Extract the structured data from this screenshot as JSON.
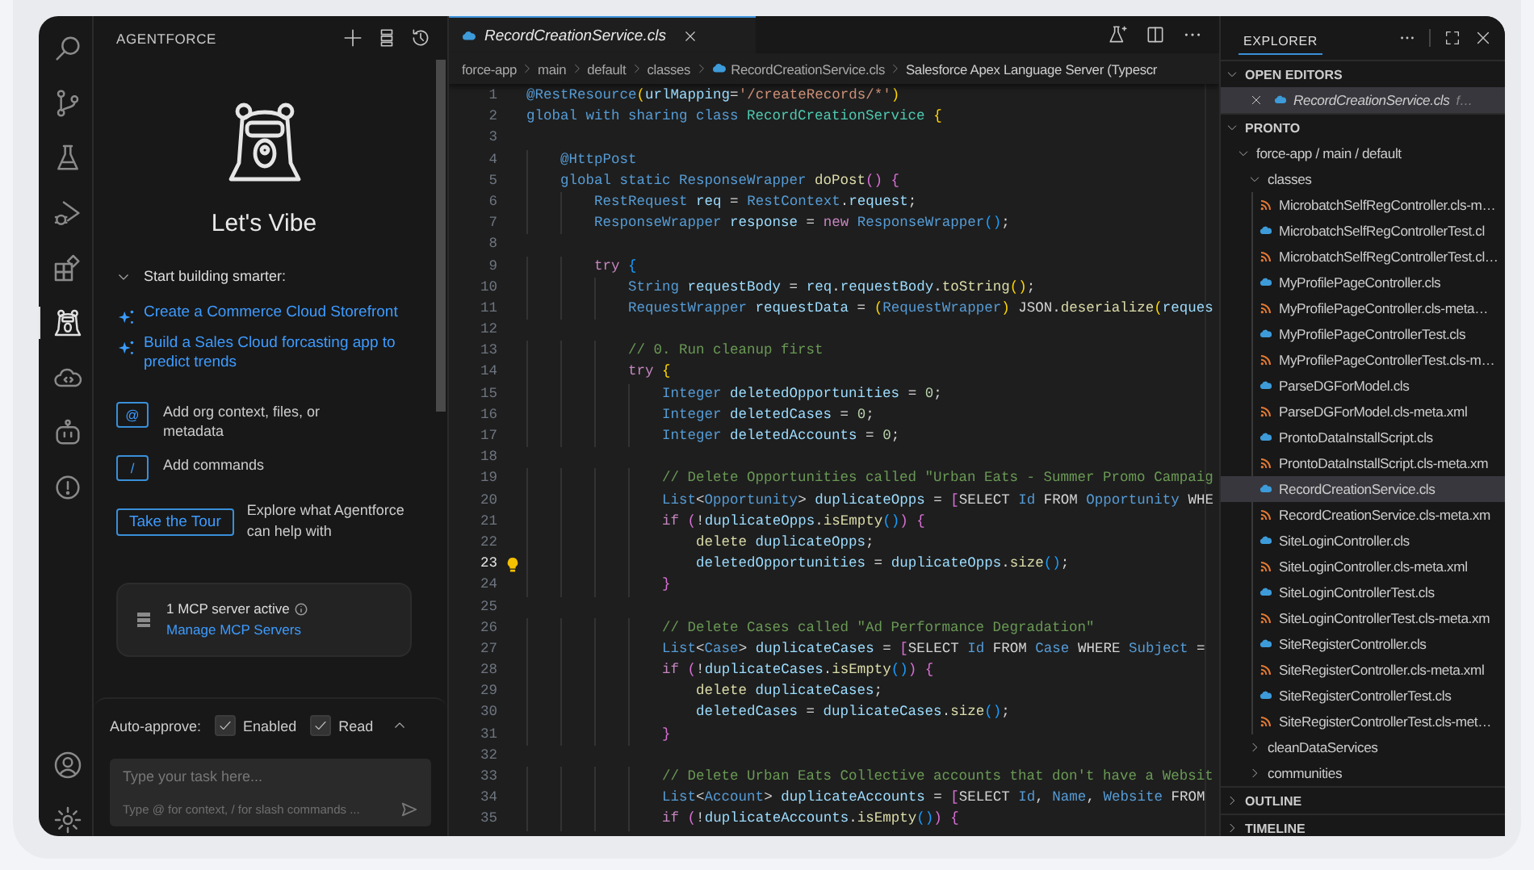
{
  "activity_bar": {
    "items": [
      {
        "kind": "search",
        "selected": false
      },
      {
        "kind": "source-control",
        "selected": false
      },
      {
        "kind": "flask",
        "selected": false
      },
      {
        "kind": "run-debug",
        "selected": false
      },
      {
        "kind": "extensions",
        "selected": false
      },
      {
        "kind": "agent",
        "selected": true
      },
      {
        "kind": "cloud",
        "selected": false
      },
      {
        "kind": "robot",
        "selected": false
      },
      {
        "kind": "alert",
        "selected": false
      }
    ],
    "bottom_items": [
      {
        "kind": "account",
        "selected": false
      },
      {
        "kind": "gear",
        "selected": false
      }
    ]
  },
  "agent_panel": {
    "title": "AGENTFORCE",
    "heading": "Let's Vibe",
    "section": {
      "label": "Start building smarter:",
      "expanded": true
    },
    "suggestions": [
      "Create a Commerce Cloud Storefront",
      "Build a Sales Cloud forcasting app to predict trends"
    ],
    "hints": [
      {
        "key": "@",
        "label": "Add org context, files, or metadata"
      },
      {
        "key": "/",
        "label": "Add commands"
      }
    ],
    "tour": {
      "button": "Take the Tour",
      "text": "Explore what Agentforce can help with"
    },
    "mcp": {
      "status": "1 MCP server active",
      "link": "Manage MCP Servers"
    },
    "auto_approve": {
      "label": "Auto-approve:",
      "expanded": false,
      "options": [
        {
          "label": "Enabled",
          "checked": true
        },
        {
          "label": "Read",
          "checked": true
        }
      ]
    },
    "input": {
      "placeholder": "Type your task here...",
      "hint": "Type @ for context, / for slash commands ..."
    }
  },
  "editor": {
    "tabs": [
      {
        "label": "RecordCreationService.cls",
        "selected": true
      }
    ],
    "breadcrumbs": [
      {
        "kind": "folder",
        "label": "force-app"
      },
      {
        "kind": "folder",
        "label": "main"
      },
      {
        "kind": "folder",
        "label": "default"
      },
      {
        "kind": "folder",
        "label": "classes"
      },
      {
        "kind": "file",
        "label": "RecordCreationService.cls"
      },
      {
        "kind": "symbol",
        "label": "Salesforce Apex Language Server (Typescr"
      }
    ],
    "lines": [
      {
        "number": "1",
        "current": false,
        "lightbulb": false,
        "tokens": [
          {
            "kind": "kw",
            "text": "@RestResource"
          },
          {
            "kind": "b1",
            "text": "("
          },
          {
            "kind": "var",
            "text": "urlMapping"
          },
          {
            "kind": "plain",
            "text": "="
          },
          {
            "kind": "str",
            "text": "'/createRecords/*'"
          },
          {
            "kind": "b1",
            "text": ")"
          }
        ]
      },
      {
        "number": "2",
        "current": false,
        "lightbulb": false,
        "tokens": [
          {
            "kind": "kw",
            "text": "global with sharing class "
          },
          {
            "kind": "cls",
            "text": "RecordCreationService"
          },
          {
            "kind": "b1",
            "text": " {"
          }
        ]
      },
      {
        "number": "3",
        "current": false,
        "lightbulb": false
      },
      {
        "number": "4",
        "current": false,
        "lightbulb": false,
        "tokens": [
          {
            "kind": "kw",
            "text": "    @HttpPost"
          }
        ]
      },
      {
        "number": "5",
        "current": false,
        "lightbulb": false,
        "tokens": [
          {
            "kind": "kw",
            "text": "    global static ResponseWrapper "
          },
          {
            "kind": "fn",
            "text": "doPost"
          },
          {
            "kind": "b2",
            "text": "() {"
          }
        ]
      },
      {
        "number": "6",
        "current": false,
        "lightbulb": false,
        "tokens": [
          {
            "kind": "kw",
            "text": "        RestRequest "
          },
          {
            "kind": "var",
            "text": "req"
          },
          {
            "kind": "plain",
            "text": " = "
          },
          {
            "kind": "kw",
            "text": "RestContext"
          },
          {
            "kind": "plain",
            "text": "."
          },
          {
            "kind": "var",
            "text": "request"
          },
          {
            "kind": "plain",
            "text": ";"
          }
        ]
      },
      {
        "number": "7",
        "current": false,
        "lightbulb": false,
        "tokens": [
          {
            "kind": "kw",
            "text": "        ResponseWrapper "
          },
          {
            "kind": "var",
            "text": "response"
          },
          {
            "kind": "plain",
            "text": " = "
          },
          {
            "kind": "ctl",
            "text": "new "
          },
          {
            "kind": "kw",
            "text": "ResponseWrapper"
          },
          {
            "kind": "b3",
            "text": "()"
          },
          {
            "kind": "plain",
            "text": ";"
          }
        ]
      },
      {
        "number": "8",
        "current": false,
        "lightbulb": false
      },
      {
        "number": "9",
        "current": false,
        "lightbulb": false,
        "tokens": [
          {
            "kind": "ctl",
            "text": "        try "
          },
          {
            "kind": "b3",
            "text": "{"
          }
        ]
      },
      {
        "number": "10",
        "current": false,
        "lightbulb": false,
        "tokens": [
          {
            "kind": "kw",
            "text": "            String "
          },
          {
            "kind": "var",
            "text": "requestBody"
          },
          {
            "kind": "plain",
            "text": " = "
          },
          {
            "kind": "var",
            "text": "req"
          },
          {
            "kind": "plain",
            "text": "."
          },
          {
            "kind": "var",
            "text": "requestBody"
          },
          {
            "kind": "plain",
            "text": "."
          },
          {
            "kind": "fn",
            "text": "toString"
          },
          {
            "kind": "b1",
            "text": "()"
          },
          {
            "kind": "plain",
            "text": ";"
          }
        ]
      },
      {
        "number": "11",
        "current": false,
        "lightbulb": false,
        "tokens": [
          {
            "kind": "kw",
            "text": "            RequestWrapper "
          },
          {
            "kind": "var",
            "text": "requestData"
          },
          {
            "kind": "plain",
            "text": " = "
          },
          {
            "kind": "b1",
            "text": "("
          },
          {
            "kind": "kw",
            "text": "RequestWrapper"
          },
          {
            "kind": "b1",
            "text": ")"
          },
          {
            "kind": "plain",
            "text": " JSON."
          },
          {
            "kind": "fn",
            "text": "deserialize"
          },
          {
            "kind": "b1",
            "text": "("
          },
          {
            "kind": "var",
            "text": "reques"
          }
        ]
      },
      {
        "number": "12",
        "current": false,
        "lightbulb": false
      },
      {
        "number": "13",
        "current": false,
        "lightbulb": false,
        "tokens": [
          {
            "kind": "cm",
            "text": "            // 0. Run cleanup first"
          }
        ]
      },
      {
        "number": "14",
        "current": false,
        "lightbulb": false,
        "tokens": [
          {
            "kind": "ctl",
            "text": "            try "
          },
          {
            "kind": "b1",
            "text": "{"
          }
        ]
      },
      {
        "number": "15",
        "current": false,
        "lightbulb": false,
        "tokens": [
          {
            "kind": "kw",
            "text": "                Integer "
          },
          {
            "kind": "var",
            "text": "deletedOpportunities"
          },
          {
            "kind": "plain",
            "text": " = "
          },
          {
            "kind": "num",
            "text": "0"
          },
          {
            "kind": "plain",
            "text": ";"
          }
        ]
      },
      {
        "number": "16",
        "current": false,
        "lightbulb": false,
        "tokens": [
          {
            "kind": "kw",
            "text": "                Integer "
          },
          {
            "kind": "var",
            "text": "deletedCases"
          },
          {
            "kind": "plain",
            "text": " = "
          },
          {
            "kind": "num",
            "text": "0"
          },
          {
            "kind": "plain",
            "text": ";"
          }
        ]
      },
      {
        "number": "17",
        "current": false,
        "lightbulb": false,
        "tokens": [
          {
            "kind": "kw",
            "text": "                Integer "
          },
          {
            "kind": "var",
            "text": "deletedAccounts"
          },
          {
            "kind": "plain",
            "text": " = "
          },
          {
            "kind": "num",
            "text": "0"
          },
          {
            "kind": "plain",
            "text": ";"
          }
        ]
      },
      {
        "number": "18",
        "current": false,
        "lightbulb": false
      },
      {
        "number": "19",
        "current": false,
        "lightbulb": false,
        "tokens": [
          {
            "kind": "cm",
            "text": "                // Delete Opportunities called \"Urban Eats - Summer Promo Campaig"
          }
        ]
      },
      {
        "number": "20",
        "current": false,
        "lightbulb": false,
        "tokens": [
          {
            "kind": "kw",
            "text": "                List"
          },
          {
            "kind": "plain",
            "text": "<"
          },
          {
            "kind": "kw",
            "text": "Opportunity"
          },
          {
            "kind": "plain",
            "text": "> "
          },
          {
            "kind": "var",
            "text": "duplicateOpps"
          },
          {
            "kind": "plain",
            "text": " = "
          },
          {
            "kind": "b2",
            "text": "["
          },
          {
            "kind": "plain",
            "text": "SELECT "
          },
          {
            "kind": "kw",
            "text": "Id"
          },
          {
            "kind": "plain",
            "text": " FROM "
          },
          {
            "kind": "kw",
            "text": "Opportunity"
          },
          {
            "kind": "plain",
            "text": " WHE"
          }
        ]
      },
      {
        "number": "21",
        "current": false,
        "lightbulb": false,
        "tokens": [
          {
            "kind": "ctl",
            "text": "                if "
          },
          {
            "kind": "b2",
            "text": "("
          },
          {
            "kind": "plain",
            "text": "!"
          },
          {
            "kind": "var",
            "text": "duplicateOpps"
          },
          {
            "kind": "plain",
            "text": "."
          },
          {
            "kind": "fn",
            "text": "isEmpty"
          },
          {
            "kind": "b3",
            "text": "()"
          },
          {
            "kind": "b2",
            "text": ") {"
          }
        ]
      },
      {
        "number": "22",
        "current": false,
        "lightbulb": false,
        "tokens": [
          {
            "kind": "fn",
            "text": "                    delete "
          },
          {
            "kind": "var",
            "text": "duplicateOpps"
          },
          {
            "kind": "plain",
            "text": ";"
          }
        ]
      },
      {
        "number": "23",
        "current": true,
        "lightbulb": true,
        "tokens": [
          {
            "kind": "var",
            "text": "                    deletedOpportunities"
          },
          {
            "kind": "plain",
            "text": " = "
          },
          {
            "kind": "var",
            "text": "duplicateOpps"
          },
          {
            "kind": "plain",
            "text": "."
          },
          {
            "kind": "fn",
            "text": "size"
          },
          {
            "kind": "b3",
            "text": "()"
          },
          {
            "kind": "plain",
            "text": ";"
          }
        ]
      },
      {
        "number": "24",
        "current": false,
        "lightbulb": false,
        "tokens": [
          {
            "kind": "b2",
            "text": "                }"
          }
        ]
      },
      {
        "number": "25",
        "current": false,
        "lightbulb": false
      },
      {
        "number": "26",
        "current": false,
        "lightbulb": false,
        "tokens": [
          {
            "kind": "cm",
            "text": "                // Delete Cases called \"Ad Performance Degradation\""
          }
        ]
      },
      {
        "number": "27",
        "current": false,
        "lightbulb": false,
        "tokens": [
          {
            "kind": "kw",
            "text": "                List"
          },
          {
            "kind": "plain",
            "text": "<"
          },
          {
            "kind": "kw",
            "text": "Case"
          },
          {
            "kind": "plain",
            "text": "> "
          },
          {
            "kind": "var",
            "text": "duplicateCases"
          },
          {
            "kind": "plain",
            "text": " = "
          },
          {
            "kind": "b2",
            "text": "["
          },
          {
            "kind": "plain",
            "text": "SELECT "
          },
          {
            "kind": "kw",
            "text": "Id"
          },
          {
            "kind": "plain",
            "text": " FROM "
          },
          {
            "kind": "kw",
            "text": "Case"
          },
          {
            "kind": "plain",
            "text": " WHERE "
          },
          {
            "kind": "kw",
            "text": "Subject"
          },
          {
            "kind": "plain",
            "text": " ="
          }
        ]
      },
      {
        "number": "28",
        "current": false,
        "lightbulb": false,
        "tokens": [
          {
            "kind": "ctl",
            "text": "                if "
          },
          {
            "kind": "b2",
            "text": "("
          },
          {
            "kind": "plain",
            "text": "!"
          },
          {
            "kind": "var",
            "text": "duplicateCases"
          },
          {
            "kind": "plain",
            "text": "."
          },
          {
            "kind": "fn",
            "text": "isEmpty"
          },
          {
            "kind": "b3",
            "text": "()"
          },
          {
            "kind": "b2",
            "text": ") {"
          }
        ]
      },
      {
        "number": "29",
        "current": false,
        "lightbulb": false,
        "tokens": [
          {
            "kind": "fn",
            "text": "                    delete "
          },
          {
            "kind": "var",
            "text": "duplicateCases"
          },
          {
            "kind": "plain",
            "text": ";"
          }
        ]
      },
      {
        "number": "30",
        "current": false,
        "lightbulb": false,
        "tokens": [
          {
            "kind": "var",
            "text": "                    deletedCases"
          },
          {
            "kind": "plain",
            "text": " = "
          },
          {
            "kind": "var",
            "text": "duplicateCases"
          },
          {
            "kind": "plain",
            "text": "."
          },
          {
            "kind": "fn",
            "text": "size"
          },
          {
            "kind": "b3",
            "text": "()"
          },
          {
            "kind": "plain",
            "text": ";"
          }
        ]
      },
      {
        "number": "31",
        "current": false,
        "lightbulb": false,
        "tokens": [
          {
            "kind": "b2",
            "text": "                }"
          }
        ]
      },
      {
        "number": "32",
        "current": false,
        "lightbulb": false
      },
      {
        "number": "33",
        "current": false,
        "lightbulb": false,
        "tokens": [
          {
            "kind": "cm",
            "text": "                // Delete Urban Eats Collective accounts that don't have a Websit"
          }
        ]
      },
      {
        "number": "34",
        "current": false,
        "lightbulb": false,
        "tokens": [
          {
            "kind": "kw",
            "text": "                List"
          },
          {
            "kind": "plain",
            "text": "<"
          },
          {
            "kind": "kw",
            "text": "Account"
          },
          {
            "kind": "plain",
            "text": "> "
          },
          {
            "kind": "var",
            "text": "duplicateAccounts"
          },
          {
            "kind": "plain",
            "text": " = "
          },
          {
            "kind": "b2",
            "text": "["
          },
          {
            "kind": "plain",
            "text": "SELECT "
          },
          {
            "kind": "kw",
            "text": "Id"
          },
          {
            "kind": "plain",
            "text": ", "
          },
          {
            "kind": "kw",
            "text": "Name"
          },
          {
            "kind": "plain",
            "text": ", "
          },
          {
            "kind": "kw",
            "text": "Website"
          },
          {
            "kind": "plain",
            "text": " FROM"
          }
        ]
      },
      {
        "number": "35",
        "current": false,
        "lightbulb": false,
        "tokens": [
          {
            "kind": "ctl",
            "text": "                if "
          },
          {
            "kind": "b2",
            "text": "("
          },
          {
            "kind": "plain",
            "text": "!"
          },
          {
            "kind": "var",
            "text": "duplicateAccounts"
          },
          {
            "kind": "plain",
            "text": "."
          },
          {
            "kind": "fn",
            "text": "isEmpty"
          },
          {
            "kind": "b3",
            "text": "()"
          },
          {
            "kind": "b2",
            "text": ") {"
          }
        ]
      }
    ]
  },
  "explorer": {
    "title": "EXPLORER",
    "sections": [
      {
        "label": "OPEN EDITORS",
        "expanded": true,
        "items": [
          {
            "kind": "cls",
            "label": "RecordCreationService.cls",
            "description": "f…",
            "selected": true
          }
        ]
      },
      {
        "label": "PRONTO",
        "expanded": true,
        "items": [
          {
            "kind": "folder",
            "label": "force-app / main / default",
            "expanded": true,
            "selected": false,
            "children": [
              {
                "kind": "folder",
                "label": "classes",
                "expanded": true,
                "selected": false,
                "children": [
                  {
                    "kind": "xml",
                    "label": "MicrobatchSelfRegController.cls-m…",
                    "selected": false
                  },
                  {
                    "kind": "cls",
                    "label": "MicrobatchSelfRegControllerTest.cl",
                    "selected": false
                  },
                  {
                    "kind": "xml",
                    "label": "MicrobatchSelfRegControllerTest.cl…",
                    "selected": false
                  },
                  {
                    "kind": "cls",
                    "label": "MyProfilePageController.cls",
                    "selected": false
                  },
                  {
                    "kind": "xml",
                    "label": "MyProfilePageController.cls-meta…",
                    "selected": false
                  },
                  {
                    "kind": "cls",
                    "label": "MyProfilePageControllerTest.cls",
                    "selected": false
                  },
                  {
                    "kind": "xml",
                    "label": "MyProfilePageControllerTest.cls-m…",
                    "selected": false
                  },
                  {
                    "kind": "cls",
                    "label": "ParseDGForModel.cls",
                    "selected": false
                  },
                  {
                    "kind": "xml",
                    "label": "ParseDGForModel.cls-meta.xml",
                    "selected": false
                  },
                  {
                    "kind": "cls",
                    "label": "ProntoDataInstallScript.cls",
                    "selected": false
                  },
                  {
                    "kind": "xml",
                    "label": "ProntoDataInstallScript.cls-meta.xm",
                    "selected": false
                  },
                  {
                    "kind": "cls",
                    "label": "RecordCreationService.cls",
                    "selected": true
                  },
                  {
                    "kind": "xml",
                    "label": "RecordCreationService.cls-meta.xm",
                    "selected": false
                  },
                  {
                    "kind": "cls",
                    "label": "SiteLoginController.cls",
                    "selected": false
                  },
                  {
                    "kind": "xml",
                    "label": "SiteLoginController.cls-meta.xml",
                    "selected": false
                  },
                  {
                    "kind": "cls",
                    "label": "SiteLoginControllerTest.cls",
                    "selected": false
                  },
                  {
                    "kind": "xml",
                    "label": "SiteLoginControllerTest.cls-meta.xm",
                    "selected": false
                  },
                  {
                    "kind": "cls",
                    "label": "SiteRegisterController.cls",
                    "selected": false
                  },
                  {
                    "kind": "xml",
                    "label": "SiteRegisterController.cls-meta.xml",
                    "selected": false
                  },
                  {
                    "kind": "cls",
                    "label": "SiteRegisterControllerTest.cls",
                    "selected": false
                  },
                  {
                    "kind": "xml",
                    "label": "SiteRegisterControllerTest.cls-met…",
                    "selected": false
                  }
                ]
              },
              {
                "kind": "folder",
                "label": "cleanDataServices",
                "expanded": false,
                "selected": false
              },
              {
                "kind": "folder",
                "label": "communities",
                "expanded": false,
                "selected": false
              }
            ]
          }
        ]
      },
      {
        "label": "OUTLINE",
        "expanded": false
      },
      {
        "label": "TIMELINE",
        "expanded": false
      }
    ]
  }
}
